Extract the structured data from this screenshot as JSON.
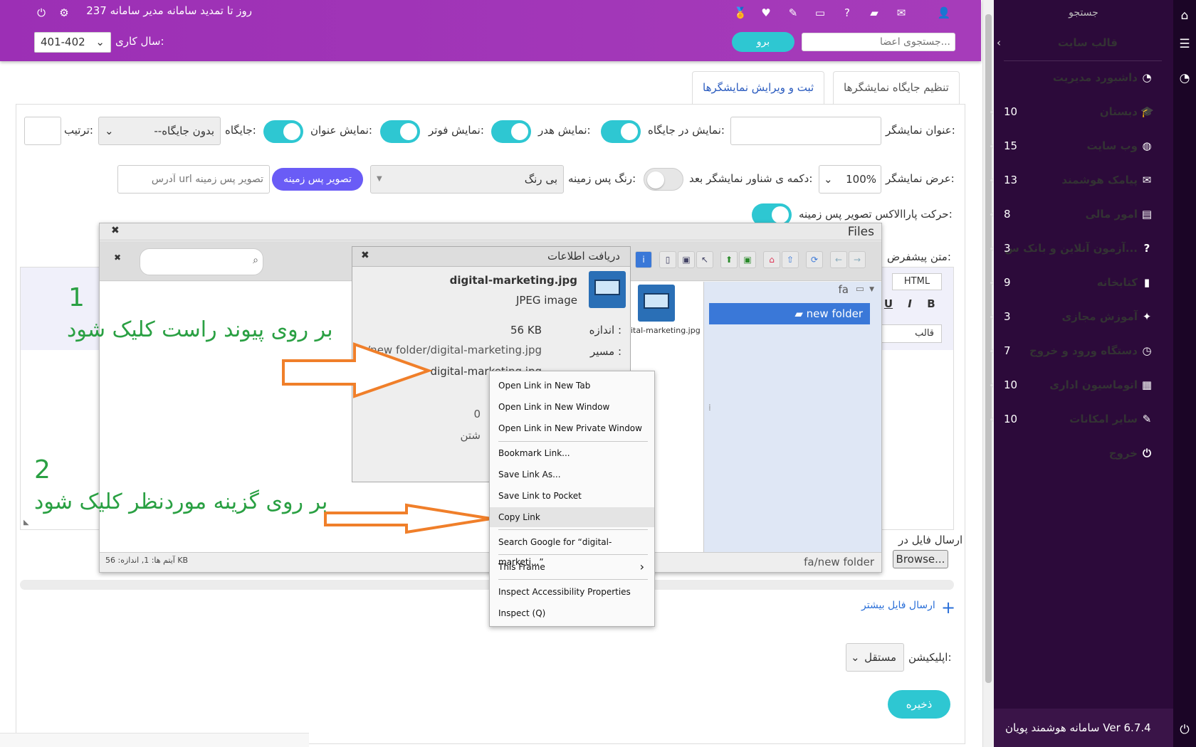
{
  "topbar": {
    "renew_text": "237 روز تا تمدید سامانه مدیر سامانه",
    "search_placeholder": "جستجوی اعضا...",
    "go_label": "برو",
    "year_label": "سال کاری:",
    "year_value": "401-402"
  },
  "sidebar": {
    "search_label": "جستجو",
    "site_template": "قالب سایت",
    "items": [
      {
        "label": "داشبورد مدیریت",
        "icon": "dashboard-icon",
        "count": ""
      },
      {
        "label": "دبستان",
        "icon": "graduation-cap-icon",
        "count": "10"
      },
      {
        "label": "وب سایت",
        "icon": "globe-icon",
        "count": "15"
      },
      {
        "label": "پیامک هوشمند",
        "icon": "chat-icon",
        "count": "13"
      },
      {
        "label": "امور مالی",
        "icon": "money-icon",
        "count": "8"
      },
      {
        "label": "آزمون آنلاین و بانک س...",
        "icon": "question-icon",
        "count": "3"
      },
      {
        "label": "کتابخانه",
        "icon": "book-icon",
        "count": "9"
      },
      {
        "label": "آموزش مجازی",
        "icon": "reader-icon",
        "count": "3"
      },
      {
        "label": "دستگاه ورود و خروج",
        "icon": "clock-icon",
        "count": "7"
      },
      {
        "label": "اتوماسیون اداری",
        "icon": "office-icon",
        "count": "10"
      },
      {
        "label": "سایر امکانات",
        "icon": "wrench-icon",
        "count": "10"
      },
      {
        "label": "خروج",
        "icon": "power-icon",
        "count": ""
      }
    ],
    "footer": "سامانه هوشمند پویان  Ver 6.7.4"
  },
  "tabs": [
    "تنظیم جایگاه نمایشگرها",
    "ثبت و ویرایش نمایشگرها"
  ],
  "form": {
    "title_label": "عنوان نمایشگر:",
    "show_in_place": "نمایش در جایگاه:",
    "show_header": "نمایش هدر:",
    "show_footer": "نمایش فوتر:",
    "show_title": "نمایش عنوان:",
    "place_label": "جایگاه:",
    "place_value": "--بدون جایگاه",
    "order_label": "ترتیب:",
    "width_label": "عرض نمایشگر:",
    "width_value": "100%",
    "float_btn_label": "دکمه ی شناور نمایشگر بعد:",
    "bg_color_label": "رنگ پس زمینه:",
    "bg_color_value": "بی رنگ",
    "bg_image_btn": "تصویر پس زمینه",
    "bg_url_placeholder": "آدرس url تصویر پس زمینه",
    "parallax_label": "حرکت پاراالاکس تصویر پس زمینه:",
    "default_text_label": "متن پیشفرض:",
    "editor_html": "HTML",
    "editor_template": "قالب",
    "bold": "B",
    "italic": "I",
    "underline": "U",
    "send_file_label": "ارسال فایل در",
    "browse": "Browse...",
    "more_files": "ارسال فایل بیشتر",
    "app_label": "اپلیکیشن:",
    "app_value": "مستقل",
    "save": "ذخیره"
  },
  "files_dialog": {
    "title": "Files",
    "tree_root": "fa",
    "folder": "new folder",
    "thumb_name": "ital-marketing.jpg",
    "status": "آیتم ها: 1, اندازه: 56 KB",
    "path": "fa/new folder"
  },
  "info_dialog": {
    "title": "دریافت اطلاعات",
    "filename": "digital-marketing.jpg",
    "type": "JPEG image",
    "size_label": "اندازه :",
    "size_value": "56 KB",
    "path_label": "مسیر :",
    "path_value": "fa/new folder/digital-marketing.jpg",
    "link_value": "digital-marketing.jpg",
    "extra1": "0",
    "extra2": "شتن"
  },
  "context_menu": [
    "Open Link in New Tab",
    "Open Link in New Window",
    "Open Link in New Private Window",
    "Bookmark Link...",
    "Save Link As...",
    "Save Link to Pocket",
    "Copy Link",
    "Search Google for “digital-marketi...”",
    "This Frame",
    "Inspect Accessibility Properties",
    "Inspect (Q)"
  ],
  "annotations": {
    "n1": "1",
    "t1": "بر روی پیوند راست کلیک شود",
    "n2": "2",
    "t2": "بر روی گزینه موردنظر کلیک شود"
  },
  "colors": {
    "accent": "#2ec7d2",
    "topbar": "#a63cba",
    "sidebar": "#2c0a3a",
    "arrow": "#f07f2a",
    "annotation": "#2aa043"
  }
}
